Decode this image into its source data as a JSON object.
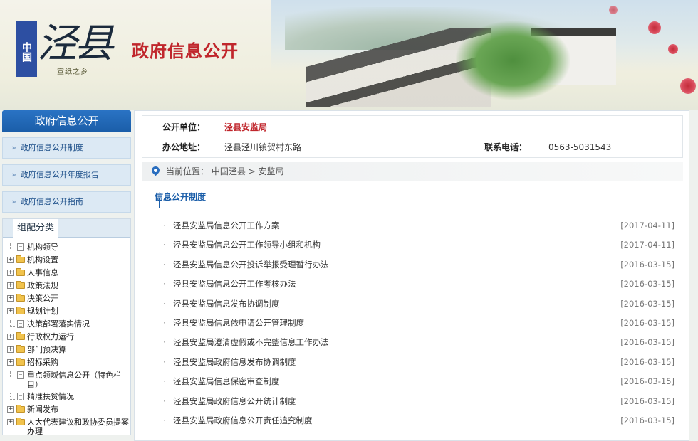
{
  "header": {
    "logo_flag": "中国",
    "logo_big": "泾县",
    "logo_tagline": "宣纸之乡",
    "site_title": "政府信息公开"
  },
  "sidebar": {
    "title": "政府信息公开",
    "links": [
      {
        "label": "政府信息公开制度"
      },
      {
        "label": "政府信息公开年度报告"
      },
      {
        "label": "政府信息公开指南"
      }
    ],
    "category_title": "组配分类",
    "tree": [
      {
        "label": "机构领导",
        "icon": "document-icon",
        "expandable": false
      },
      {
        "label": "机构设置",
        "icon": "folder-icon",
        "expandable": true
      },
      {
        "label": "人事信息",
        "icon": "folder-icon",
        "expandable": true
      },
      {
        "label": "政策法规",
        "icon": "folder-icon",
        "expandable": true
      },
      {
        "label": "决策公开",
        "icon": "folder-icon",
        "expandable": true
      },
      {
        "label": "规划计划",
        "icon": "folder-icon",
        "expandable": true
      },
      {
        "label": "决策部署落实情况",
        "icon": "document-icon",
        "expandable": false
      },
      {
        "label": "行政权力运行",
        "icon": "folder-icon",
        "expandable": true
      },
      {
        "label": "部门预决算",
        "icon": "folder-icon",
        "expandable": true
      },
      {
        "label": "招标采购",
        "icon": "folder-icon",
        "expandable": true
      },
      {
        "label": "重点领域信息公开（特色栏目）",
        "icon": "document-icon",
        "expandable": false
      },
      {
        "label": "精准扶贫情况",
        "icon": "document-icon",
        "expandable": false
      },
      {
        "label": "新闻发布",
        "icon": "folder-icon",
        "expandable": true
      },
      {
        "label": "人大代表建议和政协委员提案办理",
        "icon": "folder-icon",
        "expandable": true
      }
    ]
  },
  "unit": {
    "unit_label": "公开单位：",
    "unit_name": "泾县安监局",
    "address_label": "办公地址：",
    "address": "泾县泾川镇贺村东路",
    "phone_label": "联系电话：",
    "phone": "0563-5031543"
  },
  "breadcrumb": {
    "text": "当前位置： 中国泾县 > 安监局"
  },
  "section": {
    "title": "信息公开制度"
  },
  "documents": [
    {
      "title": "泾县安监局信息公开工作方案",
      "date": "[2017-04-11]"
    },
    {
      "title": "泾县安监局信息公开工作领导小组和机构",
      "date": "[2017-04-11]"
    },
    {
      "title": "泾县安监局信息公开投诉举报受理暂行办法",
      "date": "[2016-03-15]"
    },
    {
      "title": "泾县安监局信息公开工作考核办法",
      "date": "[2016-03-15]"
    },
    {
      "title": "泾县安监局信息发布协调制度",
      "date": "[2016-03-15]"
    },
    {
      "title": "泾县安监局信息依申请公开管理制度",
      "date": "[2016-03-15]"
    },
    {
      "title": "泾县安监局澄清虚假或不完整信息工作办法",
      "date": "[2016-03-15]"
    },
    {
      "title": "泾县安监局政府信息发布协调制度",
      "date": "[2016-03-15]"
    },
    {
      "title": "泾县安监局信息保密审查制度",
      "date": "[2016-03-15]"
    },
    {
      "title": "泾县安监局政府信息公开统计制度",
      "date": "[2016-03-15]"
    },
    {
      "title": "泾县安监局政府信息公开责任追究制度",
      "date": "[2016-03-15]"
    }
  ],
  "colors": {
    "accent_blue": "#1b5ea9",
    "title_red": "#c0262c"
  }
}
